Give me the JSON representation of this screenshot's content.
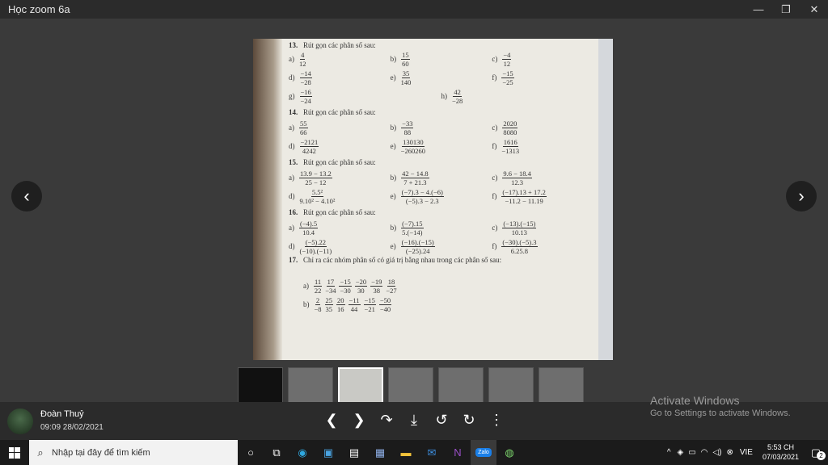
{
  "window": {
    "title": "Học zoom 6a",
    "minimize": "—",
    "maximize": "❐",
    "close": "✕"
  },
  "viewer": {
    "prev": "‹",
    "next": "›"
  },
  "page": {
    "ex13": {
      "num": "13.",
      "title": "Rút gọn các phân số sau:"
    },
    "ex14": {
      "num": "14.",
      "title": "Rút gọn các phân số sau:"
    },
    "ex15": {
      "num": "15.",
      "title": "Rút gọn các phân số sau:"
    },
    "ex16": {
      "num": "16.",
      "title": "Rút gọn các phân số sau:"
    },
    "ex17": {
      "num": "17.",
      "title": "Chỉ ra các nhóm phân số có giá trị bằng nhau trong các phân số sau:"
    },
    "r13a": [
      {
        "l": "a)",
        "n": "4",
        "d": "12"
      },
      {
        "l": "b)",
        "n": "15",
        "d": "60"
      },
      {
        "l": "c)",
        "n": "−4",
        "d": "12"
      }
    ],
    "r13b": [
      {
        "l": "d)",
        "n": "−14",
        "d": "−28"
      },
      {
        "l": "e)",
        "n": "35",
        "d": "140"
      },
      {
        "l": "f)",
        "n": "−15",
        "d": "−25"
      }
    ],
    "r13c": [
      {
        "l": "g)",
        "n": "−16",
        "d": "−24"
      },
      {
        "l": "h)",
        "n": "42",
        "d": "−28"
      }
    ],
    "r14a": [
      {
        "l": "a)",
        "n": "55",
        "d": "66"
      },
      {
        "l": "b)",
        "n": "−33",
        "d": "88"
      },
      {
        "l": "c)",
        "n": "2020",
        "d": "8080"
      }
    ],
    "r14b": [
      {
        "l": "d)",
        "n": "−2121",
        "d": "4242"
      },
      {
        "l": "e)",
        "n": "130130",
        "d": "−260260"
      },
      {
        "l": "f)",
        "n": "1616",
        "d": "−1313"
      }
    ],
    "r15a": [
      {
        "l": "a)",
        "n": "13.9 − 13.2",
        "d": "25 − 12"
      },
      {
        "l": "b)",
        "n": "42 − 14.8",
        "d": "7 + 21.3"
      },
      {
        "l": "c)",
        "n": "9.6 − 18.4",
        "d": "12.3"
      }
    ],
    "r15b": [
      {
        "l": "d)",
        "n": "5.5²",
        "d": "9.10² − 4.10²"
      },
      {
        "l": "e)",
        "n": "(−7).3 − 4.(−6)",
        "d": "(−5).3 − 2.3"
      },
      {
        "l": "f)",
        "n": "(−17).13 + 17.2",
        "d": "−11.2 − 11.19"
      }
    ],
    "r16a": [
      {
        "l": "a)",
        "n": "(−4).5",
        "d": "10.4"
      },
      {
        "l": "b)",
        "n": "(−7).15",
        "d": "5.(−14)"
      },
      {
        "l": "c)",
        "n": "(−13).(−15)",
        "d": "10.13"
      }
    ],
    "r16b": [
      {
        "l": "d)",
        "n": "(−5).22",
        "d": "(−10).(−11)"
      },
      {
        "l": "e)",
        "n": "(−16).(−15)",
        "d": "(−25).24"
      },
      {
        "l": "f)",
        "n": "(−30).(−5).3",
        "d": "6.25.8"
      }
    ],
    "r17a": [
      {
        "n": "11",
        "d": "22"
      },
      {
        "n": "17",
        "d": "−34"
      },
      {
        "n": "−15",
        "d": "−30"
      },
      {
        "n": "−20",
        "d": "30"
      },
      {
        "n": "−19",
        "d": "38"
      },
      {
        "n": "18",
        "d": "−27"
      }
    ],
    "r17b": [
      {
        "n": "2",
        "d": "−8"
      },
      {
        "n": "25",
        "d": "35"
      },
      {
        "n": "20",
        "d": "16"
      },
      {
        "n": "−11",
        "d": "44"
      },
      {
        "n": "−15",
        "d": "−21"
      },
      {
        "n": "−50",
        "d": "−40"
      }
    ],
    "r17a_label": "a)",
    "r17b_label": "b)"
  },
  "footer": {
    "user_name": "Đoàn Thuỷ",
    "timestamp": "09:09 28/02/2021",
    "activate_title": "Activate Windows",
    "activate_sub": "Go to Settings to activate Windows."
  },
  "tools": [
    {
      "name": "prev-tool",
      "glyph": "❮"
    },
    {
      "name": "next-tool",
      "glyph": "❯"
    },
    {
      "name": "share-icon",
      "glyph": "↷"
    },
    {
      "name": "download-icon",
      "glyph": "⤓"
    },
    {
      "name": "rotate-left-icon",
      "glyph": "↺"
    },
    {
      "name": "rotate-right-icon",
      "glyph": "↻"
    },
    {
      "name": "more-icon",
      "glyph": "⋮"
    }
  ],
  "taskbar": {
    "search_placeholder": "Nhập tại đây để tìm kiếm",
    "lang": "VIE",
    "time": "5:53 CH",
    "date": "07/03/2021",
    "notif_count": "2",
    "zalo": "Zalo"
  }
}
